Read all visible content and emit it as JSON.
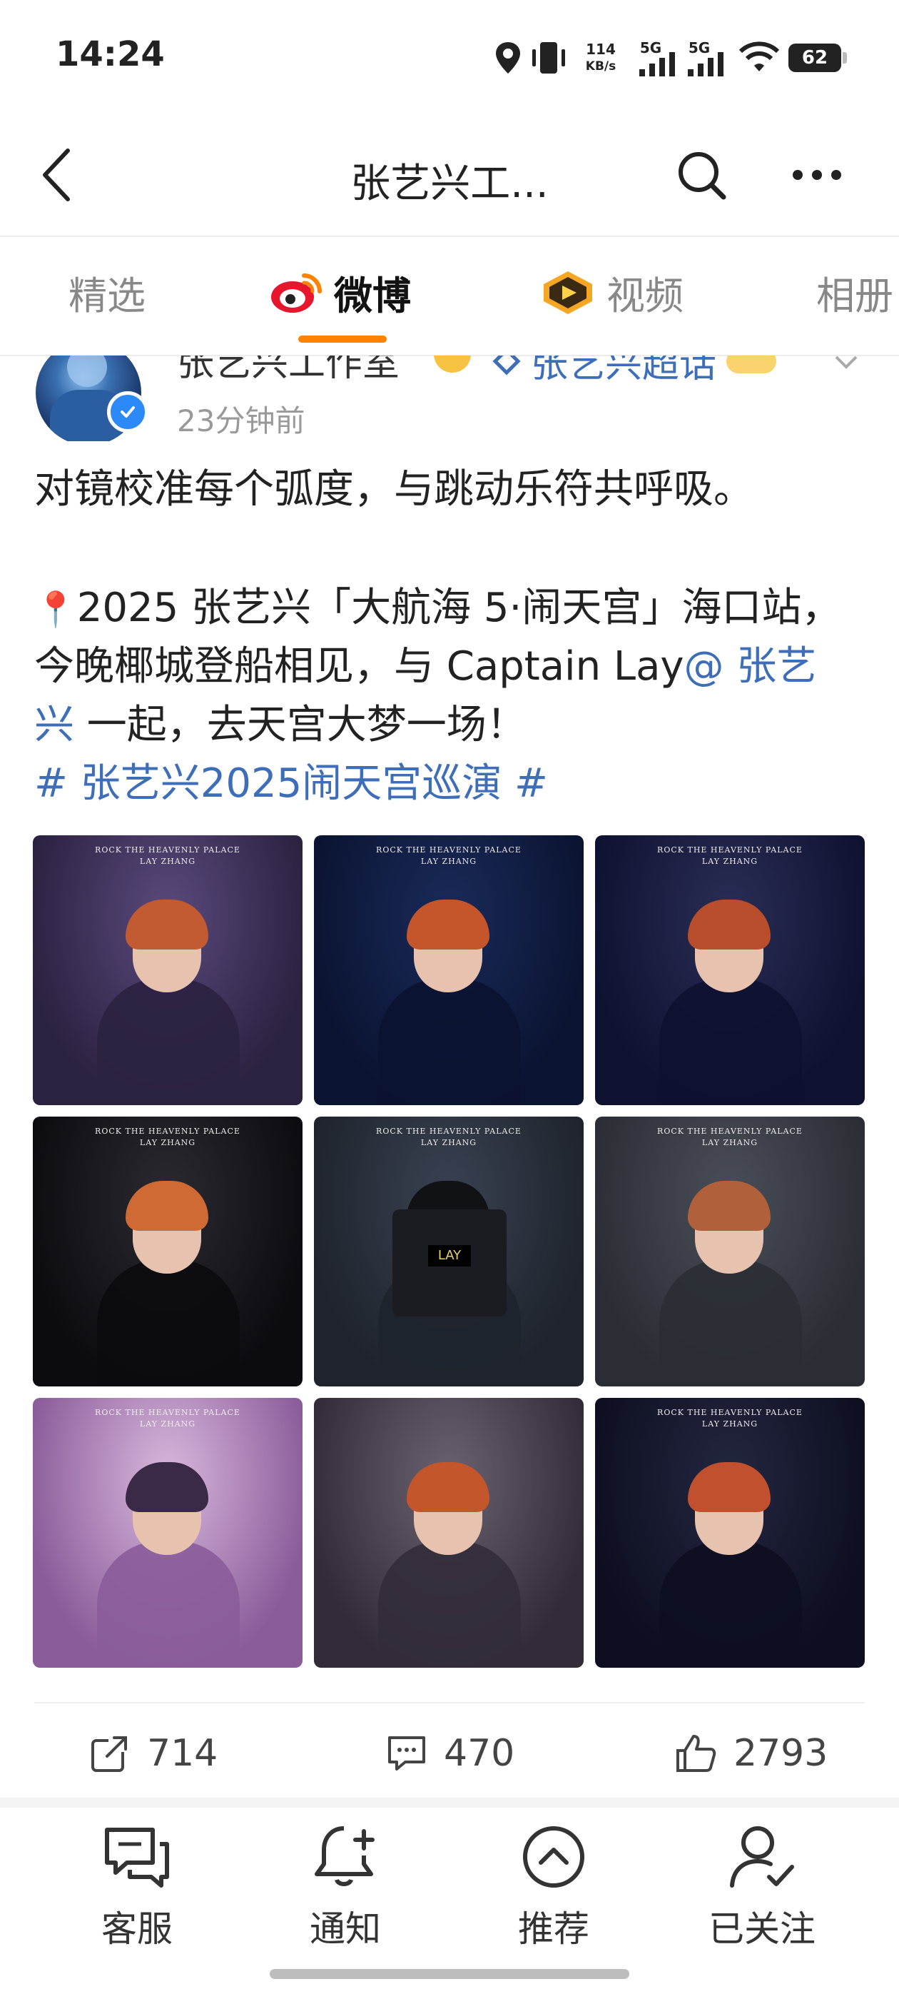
{
  "status_bar": {
    "time": "14:24",
    "net_speed_value": "114",
    "net_speed_unit": "KB/s",
    "sim1": "5G",
    "sim2": "5G",
    "battery": "62",
    "icons": [
      "location-icon",
      "vibrate-icon",
      "signal-icon",
      "signal-icon",
      "wifi-icon",
      "battery-icon"
    ]
  },
  "nav": {
    "title": "张艺兴工...",
    "back_icon": "back-arrow-icon",
    "search_icon": "search-icon",
    "more_icon": "more-icon"
  },
  "tabs": [
    {
      "label": "精选",
      "active": false
    },
    {
      "label": "微博",
      "active": true,
      "icon": "weibo-logo-icon"
    },
    {
      "label": "视频",
      "active": false,
      "icon": "video-play-icon"
    },
    {
      "label": "相册",
      "active": false
    }
  ],
  "post": {
    "author": "张艺兴工作室",
    "super_topic": "张艺兴超话",
    "time_ago": "23分钟前",
    "text_line1": "对镜校准每个弧度，与跳动乐符共呼吸。",
    "text_line2_pin": "📍",
    "text_line2": "2025 张艺兴「大航海 5·闹天宫」海口站，",
    "text_line3_pre": "今晚椰城登船相见，与 Captain Lay",
    "mention_part1": "@ 张艺",
    "mention_part2": "兴",
    "text_line4_post": " 一起，去天宫大梦一场！",
    "hashtag": "# 张艺兴2025闹天宫巡演 #",
    "images": [
      {
        "caption": "ROCK THE HEAVENLY PALACE",
        "caption2": "LAY ZHANG",
        "colors": [
          "#5a4a7c",
          "#2b2140",
          "#c25a32"
        ]
      },
      {
        "caption": "ROCK THE HEAVENLY PALACE",
        "caption2": "LAY ZHANG",
        "colors": [
          "#1a2a5a",
          "#0a1330",
          "#c5562b"
        ]
      },
      {
        "caption": "ROCK THE HEAVENLY PALACE",
        "caption2": "LAY ZHANG",
        "colors": [
          "#2a2e55",
          "#0e1130",
          "#b84e2c"
        ]
      },
      {
        "caption": "ROCK THE HEAVENLY PALACE",
        "caption2": "LAY ZHANG",
        "colors": [
          "#2a2a30",
          "#0b0b10",
          "#d06a35"
        ]
      },
      {
        "caption": "ROCK THE HEAVENLY PALACE",
        "caption2": "LAY ZHANG",
        "device_label": "LAY",
        "colors": [
          "#3a4252",
          "#1e232c",
          "#101216"
        ]
      },
      {
        "caption": "ROCK THE HEAVENLY PALACE",
        "caption2": "LAY ZHANG",
        "colors": [
          "#4a4e58",
          "#2a2d34",
          "#b0603a"
        ]
      },
      {
        "caption": "ROCK THE HEAVENLY PALACE",
        "caption2": "LAY ZHANG",
        "colors": [
          "#d8b8dc",
          "#8a5c9a",
          "#3a2a48"
        ]
      },
      {
        "caption": "",
        "caption2": "",
        "colors": [
          "#6a6270",
          "#332c38",
          "#c4562c"
        ]
      },
      {
        "caption": "ROCK THE HEAVENLY PALACE",
        "caption2": "LAY ZHANG",
        "colors": [
          "#232640",
          "#0d0f20",
          "#c0502e"
        ]
      }
    ]
  },
  "stats": {
    "reposts": "714",
    "comments": "470",
    "likes": "2793"
  },
  "bottom_nav": [
    {
      "label": "客服",
      "icon": "chat-icon"
    },
    {
      "label": "通知",
      "icon": "bell-plus-icon"
    },
    {
      "label": "推荐",
      "icon": "chevron-up-circle-icon"
    },
    {
      "label": "已关注",
      "icon": "user-check-icon"
    }
  ]
}
